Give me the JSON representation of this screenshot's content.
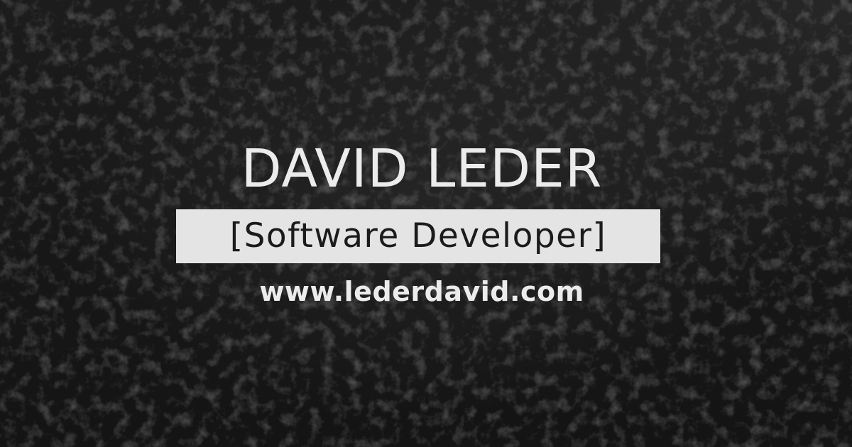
{
  "header": {
    "name": "DAVID LEDER",
    "role": "[Software Developer]",
    "url": "www.lederdavid.com"
  },
  "colors": {
    "background": "#1a1a1a",
    "text": "#ececec",
    "role_box": "#e4e4e4",
    "role_text": "#1b1b1b"
  }
}
